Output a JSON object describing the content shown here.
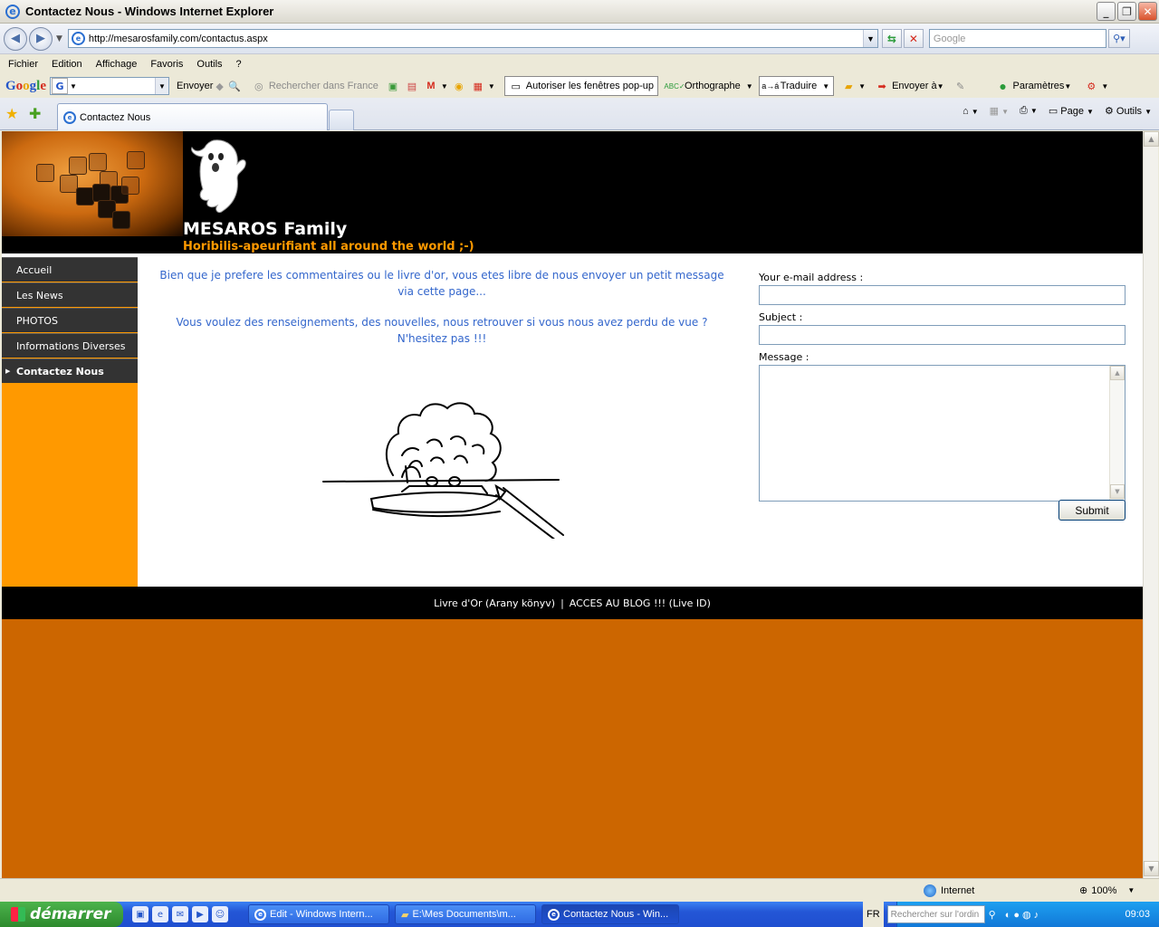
{
  "window": {
    "title": "Contactez Nous - Windows Internet Explorer"
  },
  "address_bar": {
    "url": "http://mesarosfamily.com/contactus.aspx",
    "search_placeholder": "Google"
  },
  "menu": [
    "Fichier",
    "Edition",
    "Affichage",
    "Favoris",
    "Outils",
    "?"
  ],
  "google_toolbar": {
    "send_label": "Envoyer",
    "search_label": "Rechercher dans France",
    "popup_label": "Autoriser les fenêtres pop-up",
    "spell_label": "Orthographe",
    "translate_label": "Traduire",
    "send_to_label": "Envoyer à",
    "settings_label": "Paramètres"
  },
  "tabs": {
    "active_label": "Contactez Nous"
  },
  "command_bar": {
    "page_label": "Page",
    "tools_label": "Outils"
  },
  "site": {
    "title": "MESAROS Family",
    "subtitle": "Horibilis-apeurifiant all around the world ;-)",
    "nav": [
      {
        "label": "Accueil",
        "active": false
      },
      {
        "label": "Les News",
        "active": false
      },
      {
        "label": "PHOTOS",
        "active": false
      },
      {
        "label": "Informations Diverses",
        "active": false
      },
      {
        "label": "Contactez Nous",
        "active": true
      }
    ],
    "intro_p1": "Bien que je prefere les commentaires ou le livre d'or, vous etes libre de nous envoyer un petit message via cette page...",
    "intro_p2": "Vous voulez des renseignements, des nouvelles, nous retrouver si vous nous avez perdu de vue ? N'hesitez pas !!!",
    "form": {
      "email_label": "Your e-mail address :",
      "subject_label": "Subject :",
      "message_label": "Message :",
      "submit_label": "Submit"
    },
    "footer": {
      "link1": "Livre d'Or (Arany könyv)",
      "separator": "|",
      "link2": "ACCES AU BLOG !!! (Live ID)"
    },
    "colors": {
      "header_bg": "#000000",
      "sidebar": "#ff9900",
      "page_bg": "#cc6600",
      "intro_text": "#3366cc",
      "subtitle": "#ff9900"
    }
  },
  "status_bar": {
    "zone": "Internet",
    "zoom": "100%"
  },
  "taskbar": {
    "start_label": "démarrer",
    "tasks": [
      {
        "label": "Edit - Windows Intern...",
        "active": false
      },
      {
        "label": "E:\\Mes Documents\\m...",
        "active": false
      },
      {
        "label": "Contactez Nous - Win...",
        "active": true
      }
    ],
    "lang": "FR",
    "search_placeholder": "Rechercher sur l'ordin",
    "clock": "09:03"
  }
}
